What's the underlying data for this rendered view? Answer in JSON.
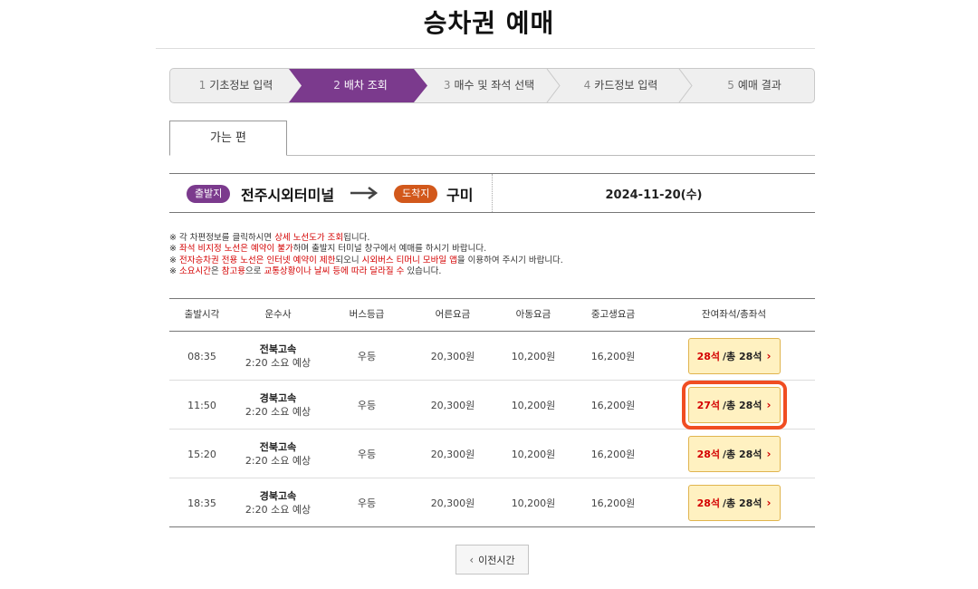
{
  "page": {
    "title": "승차권 예매"
  },
  "steps": [
    {
      "num": "1",
      "label": "기초정보 입력"
    },
    {
      "num": "2",
      "label": "배차 조회"
    },
    {
      "num": "3",
      "label": "매수 및 좌석 선택"
    },
    {
      "num": "4",
      "label": "카드정보 입력"
    },
    {
      "num": "5",
      "label": "예매 결과"
    }
  ],
  "active_step": 2,
  "tab": {
    "label": "가는 편"
  },
  "route": {
    "departure_badge": "출발지",
    "departure": "전주시외터미널",
    "arrival_badge": "도착지",
    "arrival": "구미",
    "date": "2024-11-20(수)"
  },
  "notes": [
    {
      "prefix": "※ 각 차편정보를 클릭하시면 ",
      "red": "상세 노선도가 조회",
      "suffix": "됩니다."
    },
    {
      "prefix": "※ ",
      "red": "좌석 비지정 노선은 예약이 불가",
      "suffix": "하며 출발지 터미널 창구에서 예매를 하시기 바랍니다."
    },
    {
      "prefix": "※ ",
      "red": "전자승차권 전용 노선은 인터넷 예약이 제한",
      "mid": "되오니 ",
      "red2": "시외버스 티머니 모바일 앱",
      "suffix": "을 이용하여 주시기 바랍니다."
    },
    {
      "prefix": "※ ",
      "red": "소요시간",
      "mid": "은 ",
      "red2": "참고용",
      "mid2": "으로 ",
      "red3": "교통상황이나 날씨 등에 따라 달라질 수",
      "suffix": " 있습니다."
    }
  ],
  "table": {
    "headers": [
      "출발시각",
      "운수사",
      "버스등급",
      "어른요금",
      "아동요금",
      "중고생요금",
      "잔여좌석/총좌석"
    ],
    "rows": [
      {
        "time": "08:35",
        "company": "전북고속",
        "duration": "2:20 소요 예상",
        "grade": "우등",
        "adult": "20,300원",
        "child": "10,200원",
        "teen": "16,200원",
        "remain": "28석",
        "total": "/총 28석"
      },
      {
        "time": "11:50",
        "company": "경북고속",
        "duration": "2:20 소요 예상",
        "grade": "우등",
        "adult": "20,300원",
        "child": "10,200원",
        "teen": "16,200원",
        "remain": "27석",
        "total": "/총 28석"
      },
      {
        "time": "15:20",
        "company": "전북고속",
        "duration": "2:20 소요 예상",
        "grade": "우등",
        "adult": "20,300원",
        "child": "10,200원",
        "teen": "16,200원",
        "remain": "28석",
        "total": "/총 28석"
      },
      {
        "time": "18:35",
        "company": "경북고속",
        "duration": "2:20 소요 예상",
        "grade": "우등",
        "adult": "20,300원",
        "child": "10,200원",
        "teen": "16,200원",
        "remain": "28석",
        "total": "/총 28석"
      }
    ]
  },
  "buttons": {
    "prev_time": "이전시간"
  },
  "colors": {
    "accent": "#7b3a8d",
    "arrival": "#d2581b",
    "highlight": "#f04d22",
    "seat_bg": "#fff1c1"
  }
}
